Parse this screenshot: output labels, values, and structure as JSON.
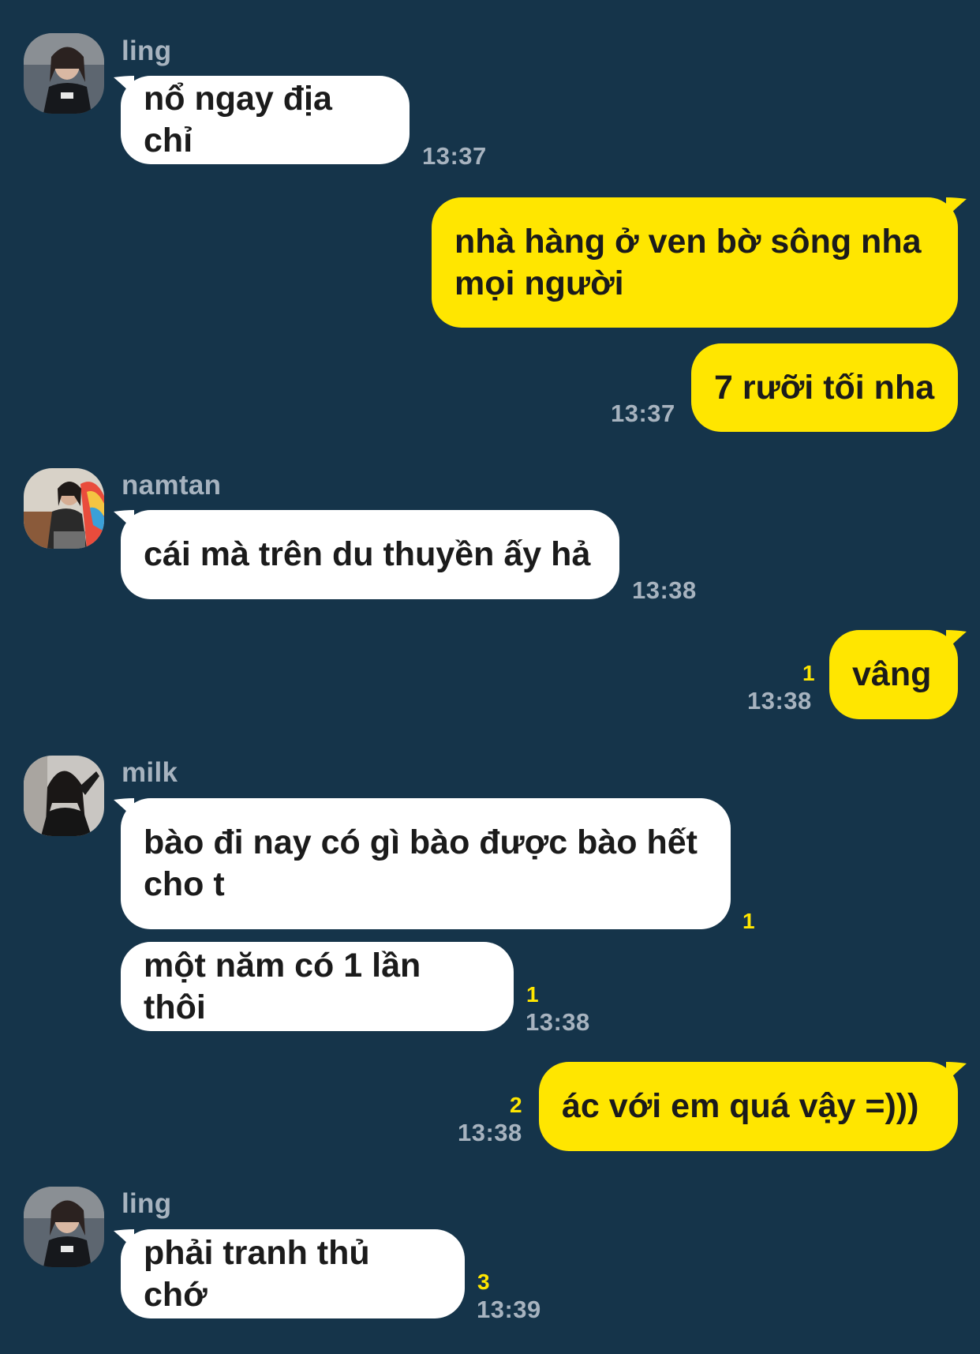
{
  "theme": {
    "background": "#15344a",
    "incoming_bubble": "#ffffff",
    "outgoing_bubble": "#ffe600",
    "meta_text": "#a7b3bf",
    "unread_count": "#ffe600"
  },
  "messages": [
    {
      "sender": "ling",
      "avatar": "avatar-ling",
      "text": "nổ ngay địa chỉ",
      "time": "13:37",
      "unread": ""
    },
    {
      "sender": "me",
      "text": "nhà hàng ở ven bờ sông nha\nmọi người",
      "time": "",
      "unread": ""
    },
    {
      "sender": "me",
      "text": "7 rưỡi tối nha",
      "time": "13:37",
      "unread": ""
    },
    {
      "sender": "namtan",
      "avatar": "avatar-namtan",
      "text": "cái mà trên du thuyền ấy hả",
      "time": "13:38",
      "unread": ""
    },
    {
      "sender": "me",
      "text": "vâng",
      "time": "13:38",
      "unread": "1"
    },
    {
      "sender": "milk",
      "avatar": "avatar-milk",
      "text": "bào đi nay có gì bào được bào hết\ncho t",
      "time": "",
      "unread": "1"
    },
    {
      "sender": "milk",
      "text": "một năm có 1 lần thôi",
      "time": "13:38",
      "unread": "1"
    },
    {
      "sender": "me",
      "text": "ác với em quá vậy =)))",
      "time": "13:38",
      "unread": "2"
    },
    {
      "sender": "ling",
      "avatar": "avatar-ling",
      "text": "phải tranh thủ chớ",
      "time": "13:39",
      "unread": "3"
    }
  ]
}
